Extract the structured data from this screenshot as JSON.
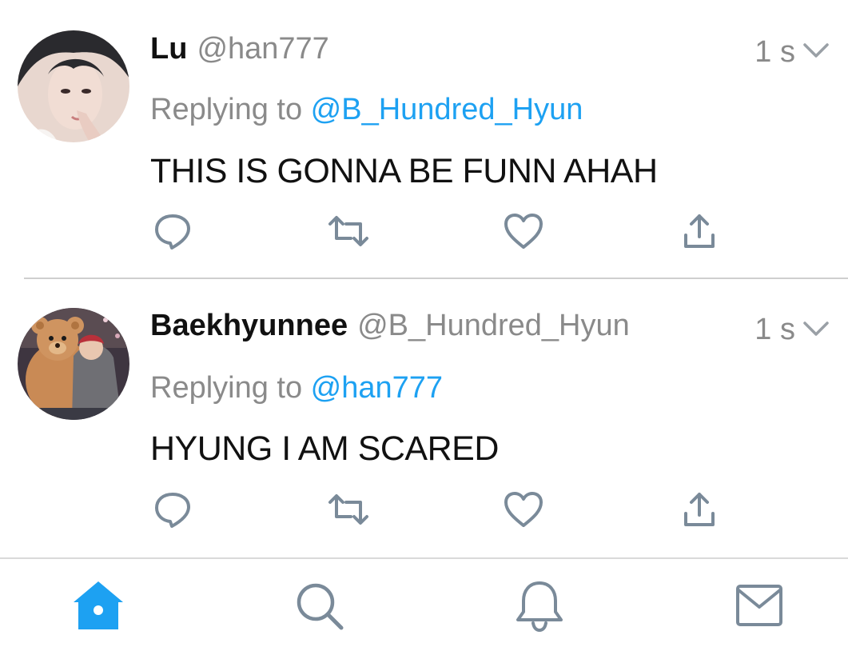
{
  "tweets": [
    {
      "name": "Lu",
      "handle": "@han777",
      "time": "1 s",
      "replying_prefix": "Replying to ",
      "replying_to": "@B_Hundred_Hyun",
      "text": "THIS IS GONNA BE FUNN AHAH",
      "avatar": "avatar-portrait"
    },
    {
      "name": "Baekhyunnee",
      "handle": "@B_Hundred_Hyun",
      "time": "1 s",
      "replying_prefix": "Replying to ",
      "replying_to": "@han777",
      "text": "HYUNG I AM SCARED",
      "avatar": "avatar-teddy-bear"
    }
  ],
  "actions": [
    "reply-icon",
    "retweet-icon",
    "like-icon",
    "share-icon"
  ],
  "tabbar": {
    "tabs": [
      "home-icon",
      "search-icon",
      "notifications-icon",
      "messages-icon"
    ],
    "active": "home-icon"
  },
  "colors": {
    "accent": "#1da1f2",
    "secondary_text": "#8a8a8a",
    "icon": "#7a8a99",
    "divider": "#cfcfcf"
  }
}
